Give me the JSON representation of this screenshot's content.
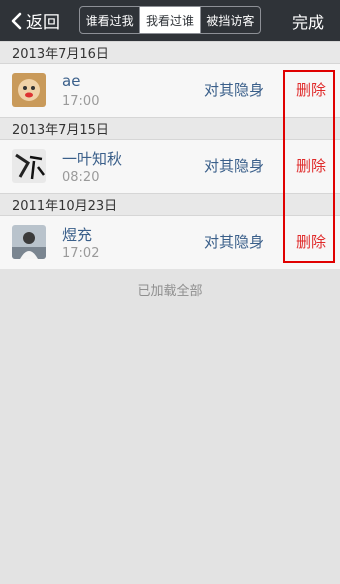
{
  "nav": {
    "back_label": "返回",
    "tabs": [
      "谁看过我",
      "我看过谁",
      "被挡访客"
    ],
    "active_tab": 1,
    "done_label": "完成"
  },
  "sections": [
    {
      "date": "2013年7月16日",
      "name": "ae",
      "time": "17:00",
      "hide_label": "对其隐身",
      "delete_label": "删除"
    },
    {
      "date": "2013年7月15日",
      "name": "一叶知秋",
      "time": "08:20",
      "hide_label": "对其隐身",
      "delete_label": "删除"
    },
    {
      "date": "2011年10月23日",
      "name": "煜充",
      "time": "17:02",
      "hide_label": "对其隐身",
      "delete_label": "删除"
    }
  ],
  "footer_text": "已加载全部",
  "colors": {
    "navbar_bg": "#2f3338",
    "name_blue": "#3a5f8a",
    "delete_red": "#e02b2b",
    "highlight_red": "#e00000"
  }
}
